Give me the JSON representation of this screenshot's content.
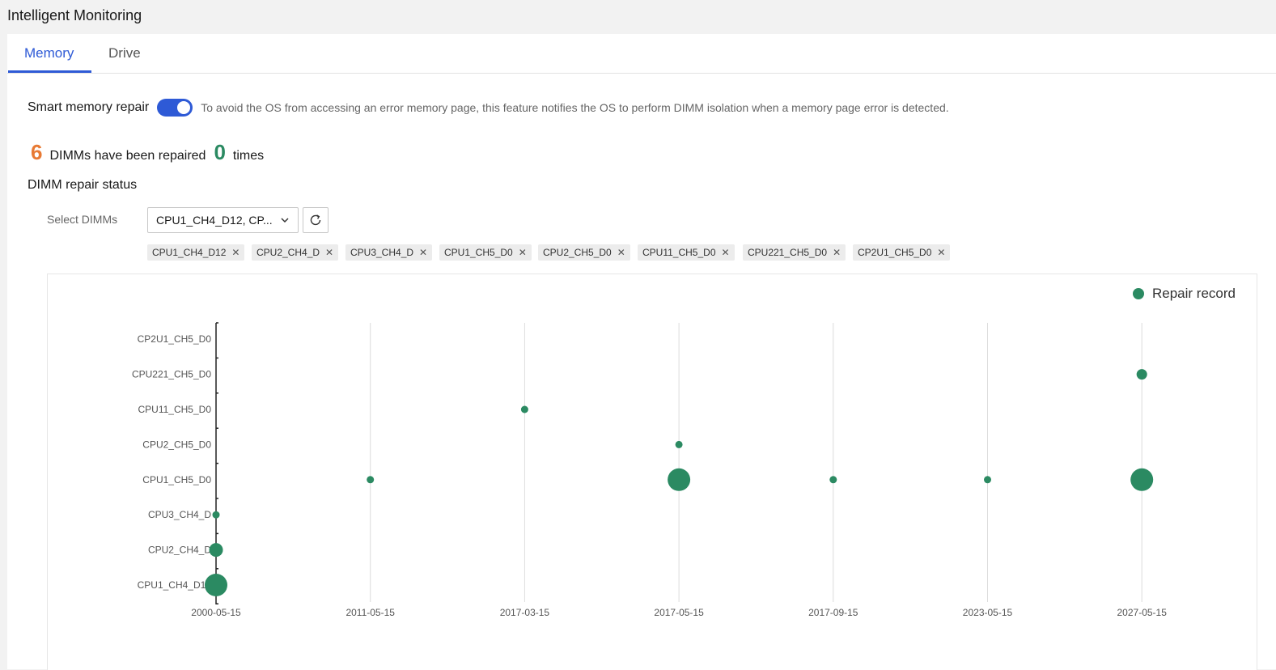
{
  "app": {
    "title": "Intelligent Monitoring"
  },
  "tabs": [
    {
      "label": "Memory",
      "active": true
    },
    {
      "label": "Drive",
      "active": false
    }
  ],
  "smart_repair": {
    "label": "Smart memory repair",
    "enabled": true,
    "description": "To avoid the OS from accessing an error memory page, this feature notifies the OS to perform DIMM isolation when a memory page error is detected."
  },
  "summary": {
    "dimm_count": "6",
    "text1": "DIMMs have been repaired",
    "times_count": "0",
    "text2": "times"
  },
  "status": {
    "title": "DIMM repair status",
    "select_label": "Select DIMMs",
    "select_value": "CPU1_CH4_D12, CP...",
    "tags": [
      "CPU1_CH4_D12",
      "CPU2_CH4_D",
      "CPU3_CH4_D",
      "CPU1_CH5_D0",
      "CPU2_CH5_D0",
      "CPU11_CH5_D0",
      "CPU221_CH5_D0",
      "CP2U1_CH5_D0"
    ]
  },
  "icons": {
    "chevron": "chevron-down-icon",
    "refresh": "refresh-icon",
    "close": "close-icon"
  },
  "colors": {
    "accent": "#2e5ad6",
    "point": "#2b8a62",
    "orange": "#e87a34"
  },
  "chart_data": {
    "type": "scatter",
    "legend": {
      "label": "Repair record",
      "position": "top-right"
    },
    "x": [
      "2000-05-15",
      "2011-05-15",
      "2017-03-15",
      "2017-05-15",
      "2017-09-15",
      "2023-05-15",
      "2027-05-15"
    ],
    "y": [
      "CPU1_CH4_D12",
      "CPU2_CH4_D",
      "CPU3_CH4_D",
      "CPU1_CH5_D0",
      "CPU2_CH5_D0",
      "CPU11_CH5_D0",
      "CPU221_CH5_D0",
      "CP2U1_CH5_D0"
    ],
    "grid": "vertical",
    "points": [
      {
        "x": "2000-05-15",
        "y": "CPU1_CH4_D12",
        "size": 3
      },
      {
        "x": "2000-05-15",
        "y": "CPU2_CH4_D",
        "size": 2
      },
      {
        "x": "2000-05-15",
        "y": "CPU3_CH4_D",
        "size": 1
      },
      {
        "x": "2011-05-15",
        "y": "CPU1_CH5_D0",
        "size": 1
      },
      {
        "x": "2017-03-15",
        "y": "CPU11_CH5_D0",
        "size": 1
      },
      {
        "x": "2017-05-15",
        "y": "CPU1_CH5_D0",
        "size": 3
      },
      {
        "x": "2017-05-15",
        "y": "CPU2_CH5_D0",
        "size": 1
      },
      {
        "x": "2017-09-15",
        "y": "CPU1_CH5_D0",
        "size": 1
      },
      {
        "x": "2023-05-15",
        "y": "CPU1_CH5_D0",
        "size": 1
      },
      {
        "x": "2027-05-15",
        "y": "CPU1_CH5_D0",
        "size": 3
      },
      {
        "x": "2027-05-15",
        "y": "CPU221_CH5_D0",
        "size": 1.5
      }
    ]
  }
}
